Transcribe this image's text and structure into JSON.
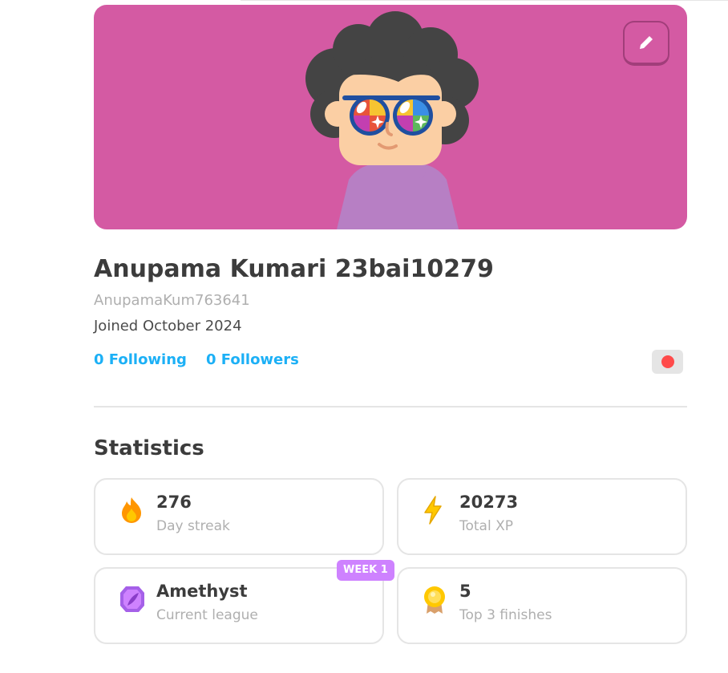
{
  "banner": {
    "background_color": "#d45aa3",
    "edit_icon": "pencil-icon"
  },
  "profile": {
    "display_name": "Anupama Kumari 23bai10279",
    "username": "AnupamaKum763641",
    "joined": "Joined October 2024",
    "following": "0 Following",
    "followers": "0 Followers",
    "flag_color": "#ff4b4b"
  },
  "statistics": {
    "title": "Statistics",
    "cards": [
      {
        "icon": "fire-icon",
        "value": "276",
        "label": "Day streak"
      },
      {
        "icon": "lightning-icon",
        "value": "20273",
        "label": "Total XP"
      },
      {
        "icon": "amethyst-league-icon",
        "value": "Amethyst",
        "label": "Current league",
        "badge": "WEEK 1"
      },
      {
        "icon": "medal-icon",
        "value": "5",
        "label": "Top 3 finishes"
      }
    ]
  },
  "colors": {
    "accent_blue": "#1cb0f6",
    "text_dark": "#3c3c3c",
    "text_muted": "#afafaf",
    "league_purple": "#ce82ff"
  }
}
